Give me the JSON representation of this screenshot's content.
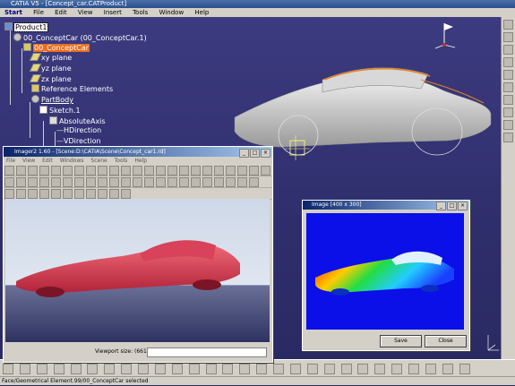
{
  "window": {
    "title": "CATIA V5 - [Concept_car.CATProduct]"
  },
  "menubar": [
    "Start",
    "File",
    "Edit",
    "View",
    "Insert",
    "Tools",
    "Window",
    "Help"
  ],
  "tree": {
    "root": "Product1",
    "product": "00_ConceptCar (00_ConceptCar.1)",
    "part": "00_ConceptCar",
    "planes": [
      "xy plane",
      "yz plane",
      "zx plane"
    ],
    "reference_elements": "Reference Elements",
    "partbody": "PartBody",
    "sketch": "Sketch.1",
    "absolute_axis": "AbsoluteAxis",
    "axis_children": [
      "HDirection",
      "VDirection"
    ]
  },
  "imager": {
    "title": "Imager2 1.60 - [Scene:D:\\CATIA\\Scene\\Concept_car1.rd]",
    "menu": [
      "File",
      "View",
      "Edit",
      "Windows",
      "Scene",
      "Tools",
      "Help"
    ],
    "viewport_size_label": "Viewport size: (661;359)"
  },
  "image_dialog": {
    "title": "Image [400 x 300]",
    "save_label": "Save",
    "close_label": "Close"
  },
  "status_bar": {
    "text": "Face/Geometrical Element.99/00_ConceptCar selected"
  },
  "colors": {
    "viewport": "#2f2e6c",
    "selection_orange": "#e86f21",
    "dialog_blue": "#0b0fe8"
  }
}
